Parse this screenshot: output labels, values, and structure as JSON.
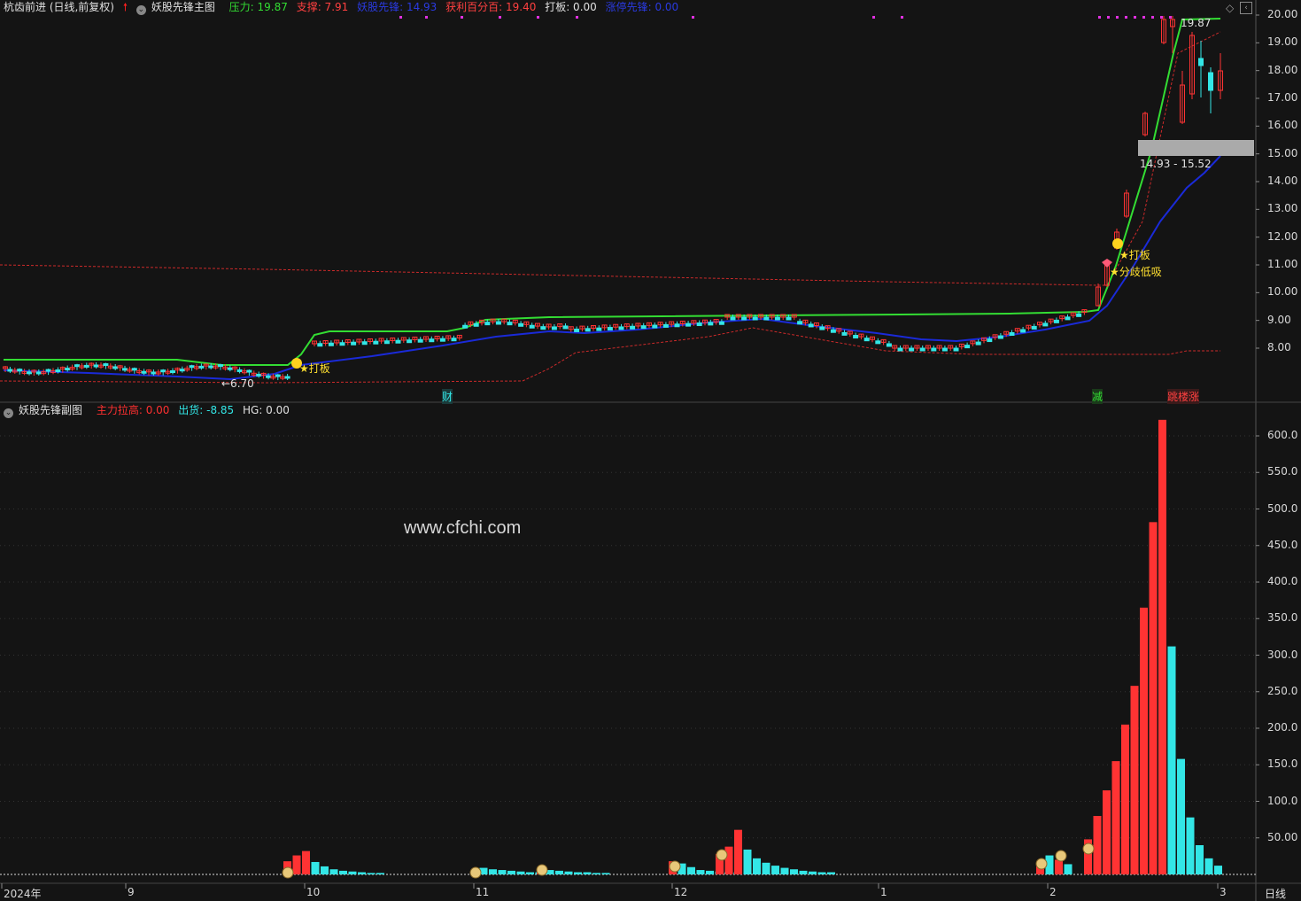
{
  "main_header": {
    "stock": "杭齿前进 (日线,前复权)",
    "indicator": "妖股先锋主图",
    "pressure": "压力: 19.87",
    "support": "支撑: 7.91",
    "pioneer": "妖股先锋: 14.93",
    "profit": "获利百分百: 19.40",
    "daban": "打板: 0.00",
    "zhangting": "涨停先锋: 0.00"
  },
  "sub_header": {
    "indicator": "妖股先锋副图",
    "pull": "主力拉高: 0.00",
    "ship": "出货: -8.85",
    "hg": "HG: 0.00"
  },
  "watermark": "www.cfchi.com",
  "main_axis": [
    "20.00",
    "19.00",
    "18.00",
    "17.00",
    "16.00",
    "15.00",
    "14.00",
    "13.00",
    "12.00",
    "11.00",
    "10.00",
    "9.00",
    "8.00"
  ],
  "sub_axis": [
    "600.0",
    "550.0",
    "500.0",
    "450.0",
    "400.0",
    "350.0",
    "300.0",
    "250.0",
    "200.0",
    "150.0",
    "100.0",
    "50.00"
  ],
  "x_axis": [
    "2024年",
    "9",
    "10",
    "11",
    "12",
    "1",
    "2",
    "3"
  ],
  "period": "日线",
  "annotations": {
    "low": "←6.70",
    "high": "19.87",
    "range": "14.93 - 15.52",
    "daban1": "★打板",
    "daban2": "★打板",
    "fenqi": "★分歧低吸",
    "cai": "财",
    "jian": "减",
    "tiaolou": "跳楼涨"
  },
  "colors": {
    "up": "#ff3333",
    "down": "#33e6e6",
    "green_line": "#33dd33",
    "blue_line": "#1a2ad8",
    "red_dash": "#cc2a2a"
  },
  "chart_data": {
    "type": "bar",
    "title": "妖股先锋副图",
    "series": [
      {
        "name": "主力拉高",
        "values": [
          18,
          26,
          32,
          17,
          11,
          7,
          5,
          4,
          3,
          2,
          2,
          5,
          9,
          7,
          6,
          5,
          4,
          3,
          3,
          3,
          8,
          6,
          5,
          4,
          3,
          3,
          2,
          2,
          18,
          15,
          10,
          6,
          5,
          4,
          3,
          3,
          28,
          38,
          61,
          34,
          22,
          16,
          12,
          9,
          7,
          5,
          4,
          3,
          3,
          18,
          26,
          20,
          14,
          48,
          80,
          115,
          155,
          205,
          258,
          365,
          482,
          622,
          312,
          158,
          78,
          40,
          22,
          12
        ]
      }
    ],
    "ylim": [
      0,
      640
    ]
  }
}
